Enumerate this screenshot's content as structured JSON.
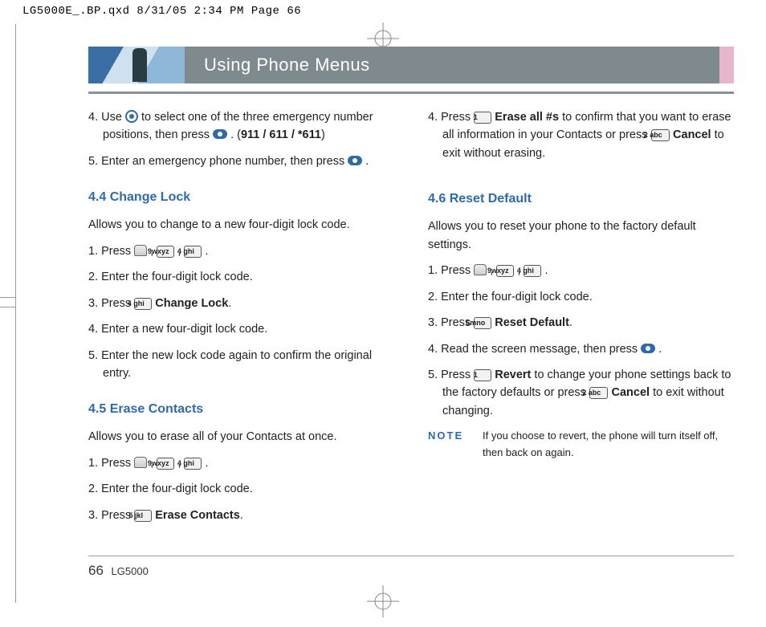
{
  "meta": {
    "qxd_header": "LG5000E_.BP.qxd  8/31/05  2:34 PM  Page 66"
  },
  "banner": {
    "title": "Using Phone Menus"
  },
  "left": {
    "s4_pre": "4. Use ",
    "s4_mid": " to select one of the three emergency number positions, then press ",
    "s4_end": " .   (",
    "s4_nums": "911 / 611 / *611",
    "s4_close": ")",
    "s5_pre": "5. Enter an emergency phone number, then press ",
    "s5_end": " .",
    "h44": "4.4 Change Lock",
    "p44": "Allows you to change to a new four-digit lock code.",
    "s44_1_a": "1. Press ",
    "s44_1_b": " ,  ",
    "s44_1_c": " ,  ",
    "s44_1_d": " .",
    "s44_2": "2. Enter the four-digit lock code.",
    "s44_3_a": "3. Press ",
    "s44_3_b": "  ",
    "s44_3_c": "Change Lock",
    "s44_3_d": ".",
    "s44_4": "4. Enter a new four-digit lock code.",
    "s44_5": "5. Enter the new lock code again to confirm the original entry.",
    "h45": "4.5 Erase Contacts",
    "p45": "Allows you to erase all of your Contacts at once.",
    "s45_1_a": "1. Press ",
    "s45_1_b": " ,  ",
    "s45_1_c": " ,  ",
    "s45_1_d": " .",
    "s45_2": "2. Enter the four-digit lock code.",
    "s45_3_a": "3. Press ",
    "s45_3_b": "  ",
    "s45_3_c": "Erase Contacts",
    "s45_3_d": "."
  },
  "right": {
    "s4_a": "4. Press ",
    "s4_b": "  ",
    "s4_c": "Erase all #s",
    "s4_d": " to confirm that you want to erase all information in your Contacts or press ",
    "s4_e": " ",
    "s4_f": "Cancel",
    "s4_g": " to exit without erasing.",
    "h46": "4.6 Reset Default",
    "p46": "Allows you to reset your phone to the factory default settings.",
    "s46_1_a": "1. Press ",
    "s46_1_b": " ,  ",
    "s46_1_c": " ,  ",
    "s46_1_d": " .",
    "s46_2": "2. Enter the four-digit lock code.",
    "s46_3_a": "3. Press ",
    "s46_3_b": "  ",
    "s46_3_c": "Reset Default",
    "s46_3_d": ".",
    "s46_4_a": "4. Read the screen message, then press ",
    "s46_4_b": " .",
    "s46_5_a": "5. Press ",
    "s46_5_b": "  ",
    "s46_5_c": "Revert",
    "s46_5_d": " to change your phone settings back to the factory defaults or press ",
    "s46_5_e": "  ",
    "s46_5_f": "Cancel",
    "s46_5_g": " to exit without changing.",
    "note_label": "NOTE",
    "note_text": "If you choose to revert, the phone will turn itself off, then back on again."
  },
  "keys": {
    "k1": "1",
    "k2": "2 abc",
    "k4": "4 ghi",
    "k5": "5 jkl",
    "k6": "6mno",
    "k9": "9wxyz"
  },
  "footer": {
    "page_num": "66",
    "model": "LG5000"
  }
}
